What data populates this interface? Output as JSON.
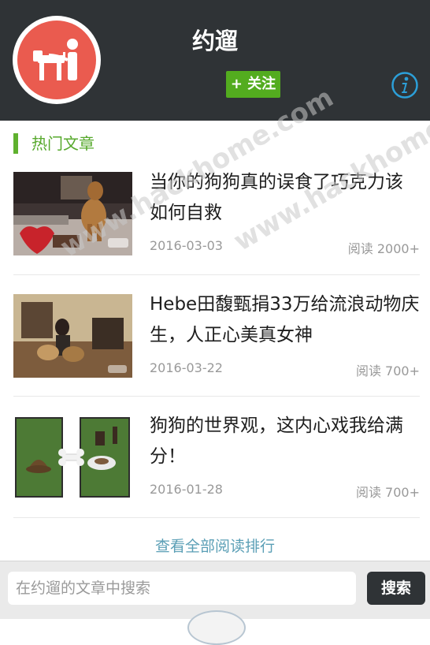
{
  "header": {
    "title": "约遛",
    "follow_label": "+ 关注",
    "avatar_icon": "dog-walker-logo-icon",
    "info_icon": "info-icon",
    "colors": {
      "background": "#2f3336",
      "avatar": "#ea5b4f",
      "follow": "#53ac1f",
      "info": "#2c9fd8"
    }
  },
  "section": {
    "title": "热门文章",
    "accent": "#5fb12e"
  },
  "articles": [
    {
      "title": "当你的狗狗真的误食了巧克力该如何自救",
      "date": "2016-03-03",
      "reads": "阅读 2000+"
    },
    {
      "title": "Hebe田馥甄捐33万给流浪动物庆生，人正心美真女神",
      "date": "2016-03-22",
      "reads": "阅读 700+"
    },
    {
      "title": "狗狗的世界观，这内心戏我给满分！",
      "date": "2016-01-28",
      "reads": "阅读 700+"
    }
  ],
  "view_all": "查看全部阅读排行",
  "search": {
    "placeholder": "在约遛的文章中搜索",
    "button_label": "搜索"
  },
  "watermark": {
    "text_1": "www.hackhome.com",
    "text_2": "www.hackhome.com"
  }
}
